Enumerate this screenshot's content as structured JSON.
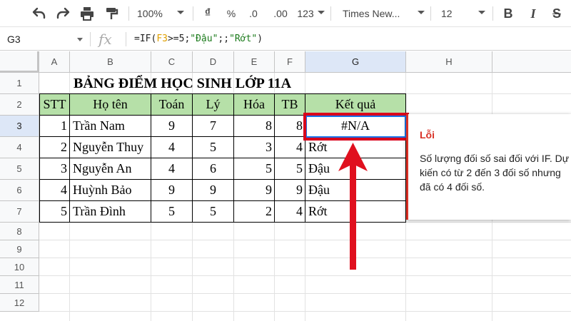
{
  "toolbar": {
    "zoom": "100%",
    "currency": "₫",
    "percent": "%",
    "decrease_decimal": ".0",
    "increase_decimal": ".00",
    "more_formats": "123",
    "font": "Times New...",
    "font_size": "12",
    "bold": "B",
    "italic": "I",
    "strikethrough": "S"
  },
  "formula_bar": {
    "name_box": "G3",
    "fx": "fx",
    "formula_parts": [
      "=IF(",
      "F3",
      ">=5;",
      "\"Đậu\"",
      ";;",
      "\"Rớt\"",
      ")"
    ]
  },
  "columns": [
    "A",
    "B",
    "C",
    "D",
    "E",
    "F",
    "G",
    "H"
  ],
  "rows": [
    "1",
    "2",
    "3",
    "4",
    "5",
    "6",
    "7",
    "8",
    "9",
    "10",
    "11",
    "12"
  ],
  "sheet": {
    "title": "BẢNG ĐIỂM HỌC SINH LỚP 11A",
    "headers": [
      "STT",
      "Họ tên",
      "Toán",
      "Lý",
      "Hóa",
      "TB",
      "Kết quả"
    ],
    "data": [
      [
        "1",
        "Trần Nam",
        "9",
        "7",
        "8",
        "8",
        "#N/A"
      ],
      [
        "2",
        "Nguyễn Thuy",
        "4",
        "5",
        "3",
        "4",
        "Rớt"
      ],
      [
        "3",
        "Nguyễn An",
        "4",
        "6",
        "5",
        "5",
        "Đậu"
      ],
      [
        "4",
        "Huỳnh Bảo",
        "9",
        "9",
        "9",
        "9",
        "Đậu"
      ],
      [
        "5",
        "Trần Đình",
        "5",
        "5",
        "2",
        "4",
        "Rớt"
      ]
    ]
  },
  "tooltip": {
    "title": "Lỗi",
    "body": "Số lượng đối số sai đối với IF. Dự kiến có từ 2 đến 3 đối số nhưng đã có 4 đối số."
  },
  "colors": {
    "header_fill": "#b6e0a8",
    "error_red": "#d93025",
    "highlight_red": "#d9001b",
    "selection_blue": "#1a73e8"
  }
}
